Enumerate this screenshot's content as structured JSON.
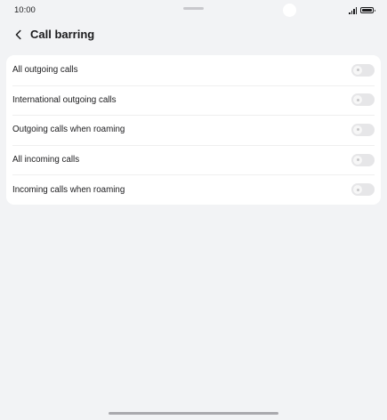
{
  "status_bar": {
    "time": "10:00"
  },
  "header": {
    "title": "Call barring",
    "back_icon": "chevron-left-icon"
  },
  "settings": [
    {
      "label": "All outgoing calls",
      "enabled": false
    },
    {
      "label": "International outgoing calls",
      "enabled": false
    },
    {
      "label": "Outgoing calls when roaming",
      "enabled": false
    },
    {
      "label": "All incoming calls",
      "enabled": false
    },
    {
      "label": "Incoming calls when roaming",
      "enabled": false
    }
  ],
  "colors": {
    "background": "#f2f3f5",
    "card": "#ffffff",
    "toggle_off": "#e6e6e8",
    "text": "#1c1c1e"
  }
}
